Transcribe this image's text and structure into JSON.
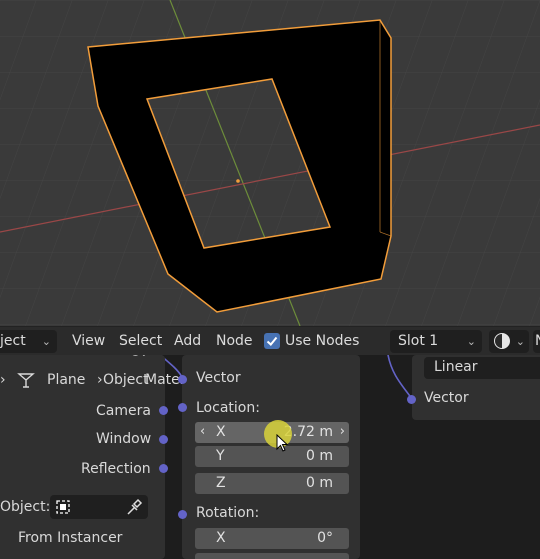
{
  "header": {
    "mode_dropdown": "ject",
    "menus": [
      "View",
      "Select",
      "Add",
      "Node"
    ],
    "use_nodes_label": "Use Nodes",
    "use_nodes_checked": true,
    "slot_label": "Slot 1",
    "truncated_right": "N"
  },
  "texcoord_node": {
    "top_partial": "UV",
    "breadcrumb": [
      "Plane",
      "Object",
      "Material"
    ],
    "outputs": [
      "Camera",
      "Window",
      "Reflection"
    ],
    "object_label": "Object:",
    "from_instancer_label": "From Instancer",
    "from_instancer_checked": false
  },
  "mapping_node": {
    "vector_label": "Vector",
    "location_label": "Location:",
    "location": [
      {
        "axis": "X",
        "value": "2.72 m"
      },
      {
        "axis": "Y",
        "value": "0 m"
      },
      {
        "axis": "Z",
        "value": "0 m"
      }
    ],
    "rotation_label": "Rotation:",
    "rotation": [
      {
        "axis": "X",
        "value": "0°"
      }
    ]
  },
  "right_node": {
    "interpolation": "Linear",
    "vector_label": "Vector"
  },
  "colors": {
    "socket_vector": "#6363c7",
    "selection_outline": "#f29d3a",
    "accent_blue": "#4772b3",
    "cursor_highlight": "#d8d23a"
  }
}
